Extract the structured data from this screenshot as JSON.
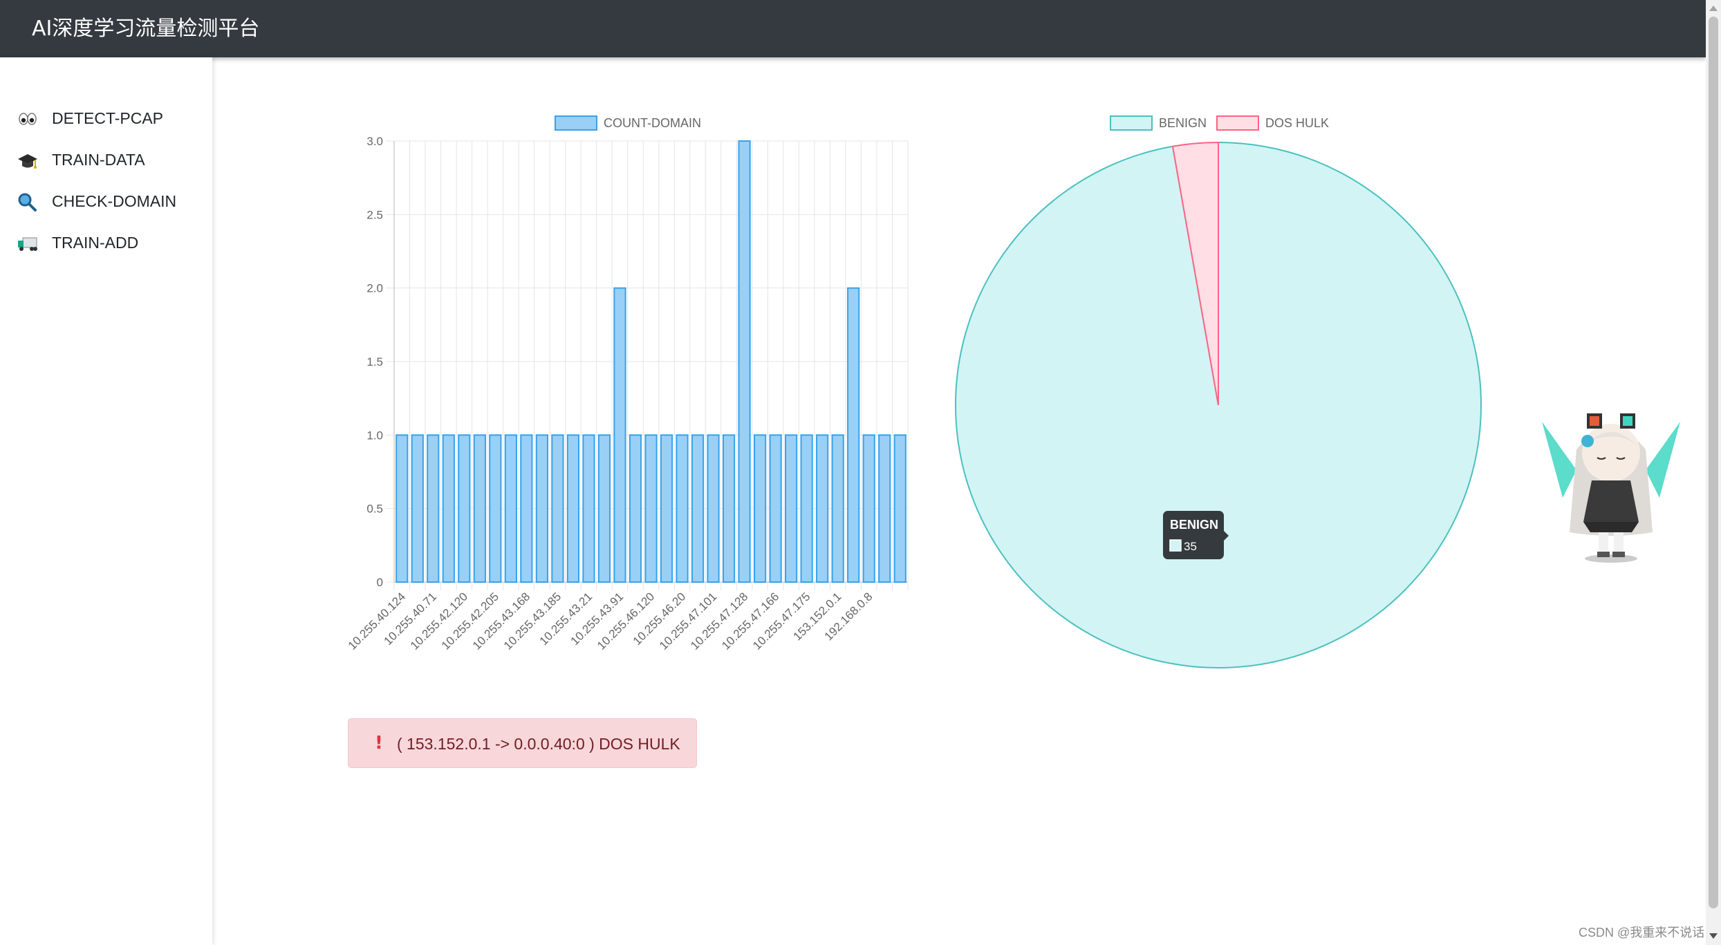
{
  "app": {
    "title": "AI深度学习流量检测平台"
  },
  "sidebar": {
    "items": [
      {
        "label": "DETECT-PCAP",
        "icon": "eyes-icon"
      },
      {
        "label": "TRAIN-DATA",
        "icon": "graduation-cap-icon"
      },
      {
        "label": "CHECK-DOMAIN",
        "icon": "magnifier-icon"
      },
      {
        "label": "TRAIN-ADD",
        "icon": "truck-icon"
      }
    ]
  },
  "chart_data": [
    {
      "type": "bar",
      "series": [
        {
          "name": "COUNT-DOMAIN",
          "values": [
            1,
            1,
            1,
            1,
            1,
            1,
            1,
            1,
            1,
            1,
            1,
            1,
            1,
            1,
            2,
            1,
            1,
            1,
            1,
            1,
            1,
            1,
            3,
            1,
            1,
            1,
            1,
            1,
            1,
            2,
            1,
            1,
            1
          ]
        }
      ],
      "x_tick_labels": [
        "10.255.40.124",
        "10.255.40.71",
        "10.255.42.120",
        "10.255.42.205",
        "10.255.43.168",
        "10.255.43.185",
        "10.255.43.21",
        "10.255.43.91",
        "10.255.46.120",
        "10.255.46.20",
        "10.255.47.101",
        "10.255.47.128",
        "10.255.47.166",
        "10.255.47.175",
        "153.152.0.1",
        "192.168.0.8"
      ],
      "y_ticks": [
        "0",
        "0.5",
        "1.0",
        "1.5",
        "2.0",
        "2.5",
        "3.0"
      ],
      "ylim": [
        0,
        3
      ],
      "grid": true,
      "legend": "top",
      "colors": {
        "fill": "#9ad0f5",
        "border": "#36a2eb"
      }
    },
    {
      "type": "pie",
      "labels": [
        "BENIGN",
        "DOS HULK"
      ],
      "values": [
        35,
        1
      ],
      "legend": "top",
      "colors": {
        "BENIGN": "#d2f4f4",
        "BENIGN_border": "#4bc0c0",
        "DOS HULK": "#ffdfe5",
        "DOS HULK_border": "#ff6384"
      },
      "tooltip": {
        "title": "BENIGN",
        "value": "35"
      }
    }
  ],
  "alert": {
    "icon": "exclamation-icon",
    "text": "( 153.152.0.1 -> 0.0.0.40:0 ) DOS HULK",
    "color": "#f8d7da"
  },
  "watermark": "CSDN @我重来不说话"
}
